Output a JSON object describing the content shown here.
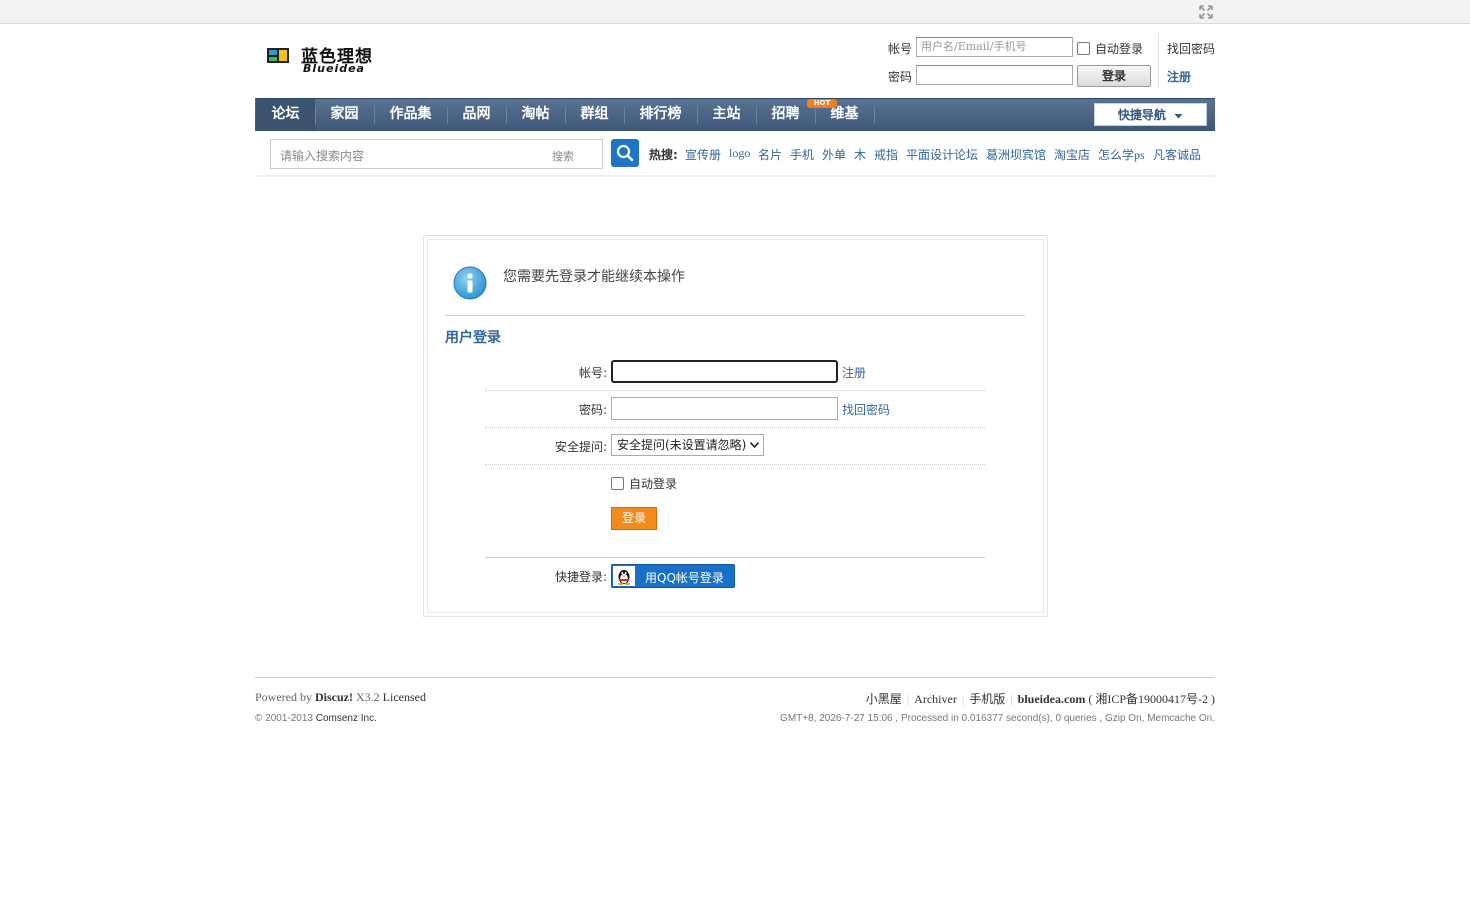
{
  "logo": {
    "cn": "蓝色理想",
    "en": "Blueidea"
  },
  "login_bar": {
    "account_label": "帐号",
    "account_placeholder": "用户名/Email/手机号",
    "password_label": "密码",
    "auto_login": "自动登录",
    "find_password": "找回密码",
    "register": "注册",
    "login_button": "登录"
  },
  "nav": {
    "items": [
      "论坛",
      "家园",
      "作品集",
      "品网",
      "淘帖",
      "群组",
      "排行榜",
      "主站",
      "招聘",
      "维基"
    ],
    "active": "论坛",
    "hot_badge": "HOT",
    "quick_nav": "快捷导航"
  },
  "search": {
    "placeholder": "请输入搜索内容",
    "type": "搜索",
    "hot_label": "热搜:",
    "hot_words": [
      "宣传册",
      "logo",
      "名片",
      "手机",
      "外单",
      "木",
      "戒指",
      "平面设计论坛",
      "葛洲坝宾馆",
      "淘宝店",
      "怎么学ps",
      "凡客诚品"
    ]
  },
  "notice": {
    "message": "您需要先登录才能继续本操作"
  },
  "login_form": {
    "title": "用户登录",
    "account_label": "帐号:",
    "register_link": "注册",
    "password_label": "密码:",
    "find_password_link": "找回密码",
    "question_label": "安全提问:",
    "question_selected": "安全提问(未设置请忽略)",
    "auto_login": "自动登录",
    "submit": "登录",
    "quick_login_label": "快捷登录:",
    "qq_login": "用QQ帐号登录"
  },
  "footer": {
    "powered_prefix": "Powered by",
    "product": "Discuz!",
    "version": "X3.2",
    "license": "Licensed",
    "copyright": "© 2001-2013",
    "company": "Comsenz Inc.",
    "links": [
      "小黑屋",
      "Archiver",
      "手机版"
    ],
    "site": "blueidea.com",
    "icp": "( 湘ICP备19000417号-2 )",
    "stats": "GMT+8, 2026-7-27 15:06 , Processed in 0.016377 second(s), 0 queries , Gzip On, Memcache On."
  },
  "colors": {
    "nav_bg": "#4b6483",
    "link": "#336699",
    "login_button": "#f38a1c",
    "qq_button": "#1870c7",
    "search_button": "#1e74c6"
  }
}
